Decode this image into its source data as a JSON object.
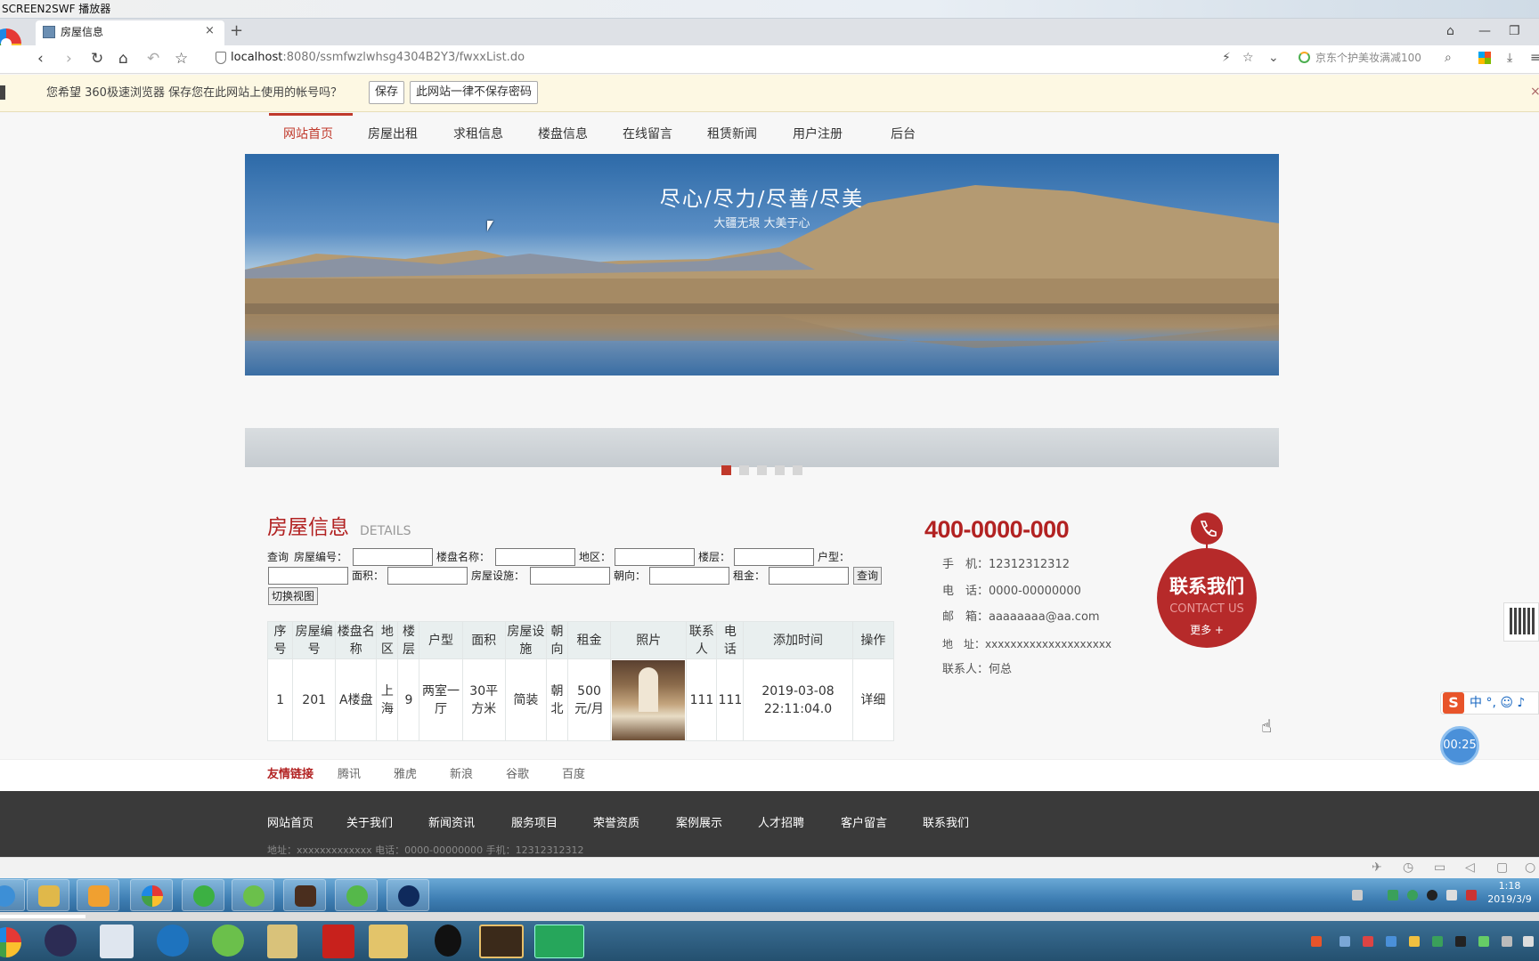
{
  "player": {
    "title": "SCREEN2SWF 播放器",
    "timer": "00:25"
  },
  "browser": {
    "tab_title": "房屋信息",
    "tab_close": "×",
    "new_tab": "+",
    "url_host": "localhost",
    "url_path": ":8080/ssmfwzlwhsg4304B2Y3/fwxxList.do",
    "search_hint": "京东个护美妆满减100",
    "nav_icons": [
      "back-icon",
      "forward-icon",
      "reload-icon",
      "home-icon",
      "undo-icon",
      "star-icon"
    ]
  },
  "password_bar": {
    "message": "您希望 360极速浏览器 保存您在此网站上使用的帐号吗？",
    "save_label": "保存",
    "never_label": "此网站一律不保存密码",
    "close": "×"
  },
  "nav": {
    "items": [
      "网站首页",
      "房屋出租",
      "求租信息",
      "楼盘信息",
      "在线留言",
      "租赁新闻",
      "用户注册",
      "后台"
    ],
    "active": "网站首页"
  },
  "banner": {
    "title": "尽心/尽力/尽善/尽美",
    "subtitle": "大疆无垠  大美于心"
  },
  "house": {
    "title": "房屋信息",
    "subtitle": "DETAILS",
    "search": {
      "query_label": "查询",
      "fields": {
        "f1": "房屋编号：",
        "f2": "楼盘名称：",
        "f3": "地区：",
        "f4": "楼层：",
        "f5": "户型：",
        "f6": "面积：",
        "f7": "房屋设施：",
        "f8": "朝向：",
        "f9": "租金："
      },
      "query_button": "查询",
      "switch_button": "切换视图"
    },
    "columns": [
      "序号",
      "房屋编号",
      "楼盘名称",
      "地区",
      "楼层",
      "户型",
      "面积",
      "房屋设施",
      "朝向",
      "租金",
      "照片",
      "联系人",
      "电话",
      "添加时间",
      "操作"
    ],
    "rows": [
      {
        "index": "1",
        "code": "201",
        "building": "A楼盘",
        "area": "上海",
        "floor": "9",
        "layout": "两室一厅",
        "size": "30平方米",
        "facility": "简装",
        "orientation": "朝北",
        "rent": "500元/月",
        "photo": "house-photo",
        "contact": "111",
        "phone": "111",
        "added": "2019-03-08 22:11:04.0",
        "action": "详细"
      }
    ]
  },
  "contact": {
    "hotline": "400-0000-000",
    "mobile": "手　机：12312312312",
    "tel": "电　话：0000-00000000",
    "email": "邮　箱：aaaaaaaa@aa.com",
    "address": "地　址：xxxxxxxxxxxxxxxxxxxx",
    "person": "联系人：何总",
    "badge_zh": "联系我们",
    "badge_en": "CONTACT US",
    "badge_more": "更多 +"
  },
  "links": {
    "title": "友情链接",
    "items": [
      "腾讯",
      "雅虎",
      "新浪",
      "谷歌",
      "百度"
    ]
  },
  "footer": {
    "nav": [
      "网站首页",
      "关于我们",
      "新闻资讯",
      "服务项目",
      "荣誉资质",
      "案例展示",
      "人才招聘",
      "客户留言",
      "联系我们"
    ],
    "info": "地址：xxxxxxxxxxxxx    电话：0000-00000000    手机：12312312312"
  },
  "taskbar": {
    "time": "1:18",
    "date": "2019/3/9"
  },
  "ime": {
    "label": "中 °, ☺ ♪"
  },
  "colors": {
    "brand": "#c0392b",
    "footer": "#3a3a3a",
    "header_row": "#e9efef"
  }
}
